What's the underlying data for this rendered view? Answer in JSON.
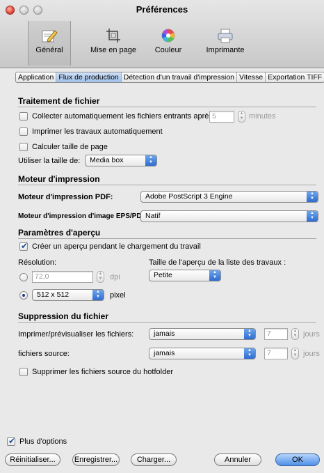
{
  "window": {
    "title": "Préférences"
  },
  "toolbar": {
    "items": [
      {
        "label": "Général",
        "icon": "pencil-notepad-icon",
        "selected": true
      },
      {
        "label": "Mise en page",
        "icon": "crop-layout-icon",
        "selected": false
      },
      {
        "label": "Couleur",
        "icon": "color-wheel-icon",
        "selected": false
      },
      {
        "label": "Imprimante",
        "icon": "printer-icon",
        "selected": false
      }
    ]
  },
  "tabs": [
    {
      "label": "Application",
      "active": false
    },
    {
      "label": "Flux de production",
      "active": true
    },
    {
      "label": "Détection d'un travail d'impression",
      "active": false
    },
    {
      "label": "Vitesse",
      "active": false
    },
    {
      "label": "Exportation TIFF",
      "active": false
    }
  ],
  "file_processing": {
    "heading": "Traitement de fichier",
    "auto_collect_label": "Collecter automatiquement les fichiers entrants après",
    "auto_collect_checked": false,
    "auto_collect_value": "5",
    "auto_collect_unit": "minutes",
    "auto_print_label": "Imprimer les travaux automatiquement",
    "auto_print_checked": false,
    "calc_page_size_label": "Calculer taille de page",
    "calc_page_size_checked": false,
    "use_size_label": "Utiliser la taille de:",
    "use_size_value": "Media box"
  },
  "print_engine": {
    "heading": "Moteur d'impression",
    "pdf_label": "Moteur d'impression PDF:",
    "pdf_value": "Adobe PostScript 3 Engine",
    "eps_label": "Moteur d'impression d'image EPS/PDF:",
    "eps_value": "Natif"
  },
  "preview": {
    "heading": "Paramètres d'aperçu",
    "create_label": "Créer un aperçu pendant le chargement du travail",
    "create_checked": true,
    "resolution_label": "Résolution:",
    "dpi_value": "72,0",
    "dpi_unit": "dpi",
    "dpi_selected": false,
    "pixel_value": "512 x 512",
    "pixel_unit": "pixel",
    "pixel_selected": true,
    "list_size_label": "Taille de l'aperçu de la liste des travaux :",
    "list_size_value": "Petite"
  },
  "deletion": {
    "heading": "Suppression du fichier",
    "print_files_label": "Imprimer/prévisualiser les fichiers:",
    "print_files_value": "jamais",
    "print_files_days": "7",
    "days_unit": "jours",
    "source_files_label": "fichiers source:",
    "source_files_value": "jamais",
    "source_files_days": "7",
    "delete_hotfolder_label": "Supprimer les fichiers source du hotfolder",
    "delete_hotfolder_checked": false
  },
  "footer": {
    "more_options_label": "Plus d'options",
    "more_options_checked": true,
    "reset_label": "Réinitialiser...",
    "save_label": "Enregistrer...",
    "load_label": "Charger...",
    "cancel_label": "Annuler",
    "ok_label": "OK"
  },
  "colors": {
    "accent": "#4f90e8",
    "background": "#e9e9e9"
  }
}
